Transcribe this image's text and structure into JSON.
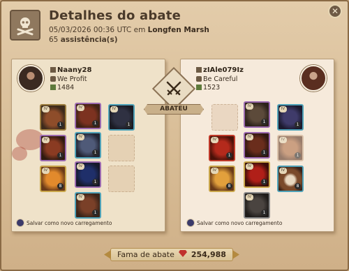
{
  "header": {
    "title": "Detalhes do abate",
    "datetime": "05/03/2026 00:36 UTC em",
    "location": "Longfen Marsh",
    "assists_count": "65",
    "assists_label": "assistência(s)",
    "icon": "skull-crossbones-icon"
  },
  "close_label": "✕",
  "killer": {
    "name": "Naany28",
    "guild": "We Profit",
    "item_power": "1484",
    "save_label": "Salvar como novo carregamento"
  },
  "victim": {
    "name": "zIAle079Iz",
    "guild": "Be Careful",
    "item_power": "1523",
    "save_label": "Salvar como novo carregamento"
  },
  "center": {
    "emblem_icon": "crossed-swords-icon",
    "banner_label": "ABATEU"
  },
  "fame": {
    "label": "Fama de abate",
    "value": "254,988",
    "icon": "fame-gem-icon"
  },
  "colors": {
    "frame": "#d7bb94",
    "panel_left": "#efe2c9",
    "panel_right": "#f6eadb",
    "text": "#4a3a2a",
    "fame_gem": "#c0322d"
  }
}
